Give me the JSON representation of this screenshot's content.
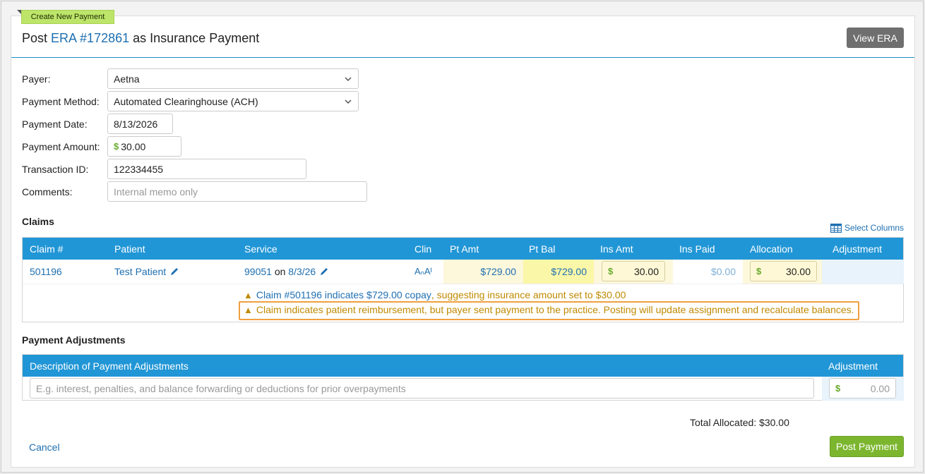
{
  "header": {
    "badge": "Create New Payment",
    "title_prefix": "Post ",
    "title_link": "ERA #172861",
    "title_suffix": " as Insurance Payment",
    "view_era_label": "View ERA"
  },
  "form": {
    "payer_label": "Payer:",
    "payer_value": "Aetna",
    "method_label": "Payment Method:",
    "method_value": "Automated Clearinghouse (ACH)",
    "date_label": "Payment Date:",
    "date_value": "8/13/2026",
    "amount_label": "Payment Amount:",
    "amount_currency": "$",
    "amount_value": "30.00",
    "txn_label": "Transaction ID:",
    "txn_value": "122334455",
    "comments_label": "Comments:",
    "comments_placeholder": "Internal memo only"
  },
  "claims": {
    "heading": "Claims",
    "select_columns": "Select Columns",
    "columns": [
      "Claim #",
      "Patient",
      "Service",
      "Clin",
      "Pt Amt",
      "Pt Bal",
      "Ins Amt",
      "Ins Paid",
      "Allocation",
      "Adjustment"
    ],
    "row": {
      "claim": "501196",
      "patient": "Test Patient",
      "service_code": "99051",
      "service_on": " on ",
      "service_date": "8/3/26",
      "clin": "AₙAᴵ",
      "pt_amt": "$729.00",
      "pt_bal": "$729.00",
      "ins_amt_currency": "$",
      "ins_amt": "30.00",
      "ins_paid": "$0.00",
      "allocation_currency": "$",
      "allocation": "30.00"
    },
    "warning1_link": "Claim #501196 indicates $729.00 copay",
    "warning1_rest": ", suggesting insurance amount set to $30.00",
    "warning2": "Claim indicates patient reimbursement, but payer sent payment to the practice. Posting will update assignment and recalculate balances."
  },
  "adjustments": {
    "heading": "Payment Adjustments",
    "col_description": "Description of Payment Adjustments",
    "col_adjustment": "Adjustment",
    "description_placeholder": "E.g. interest, penalties, and balance forwarding or deductions for prior overpayments",
    "amount_currency": "$",
    "amount_placeholder": "0.00"
  },
  "footer": {
    "total_label": "Total Allocated:",
    "total_value": "$30.00",
    "cancel_label": "Cancel",
    "post_label": "Post Payment"
  },
  "colors": {
    "accent": "#2196d6",
    "link": "#1e6fb1",
    "success": "#7cb62f",
    "warning": "#c08a00"
  }
}
